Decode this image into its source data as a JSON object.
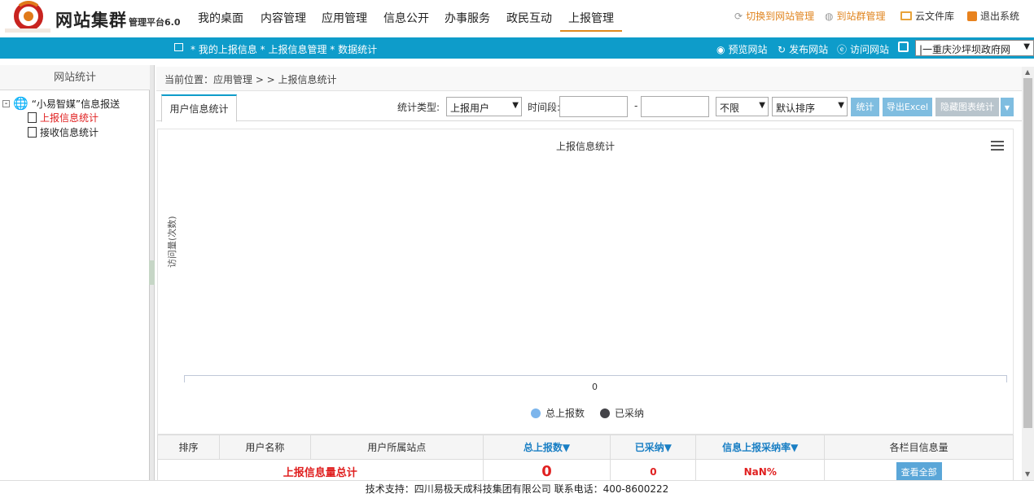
{
  "brand": {
    "name": "网站集群",
    "subtitle": "管理平台6.0"
  },
  "nav": [
    "我的桌面",
    "内容管理",
    "应用管理",
    "信息公开",
    "办事服务",
    "政民互动",
    "上报管理"
  ],
  "top_right": {
    "switch_site": "切换到网站管理",
    "cluster": "到站群管理",
    "cloud": "云文件库",
    "logout": "退出系统"
  },
  "bluebar": {
    "breadcrumb": "*  我的上报信息  *  上报信息管理  *  数据统计",
    "preview": "预览网站",
    "publish": "发布网站",
    "visit": "访问网站",
    "site_selected": "|一重庆沙坪坝政府网"
  },
  "sidebar": {
    "title": "网站统计",
    "root": "“小易智媒”信息报送",
    "items": [
      "上报信息统计",
      "接收信息统计"
    ]
  },
  "crumb": "当前位置：应用管理 > > 上报信息统计",
  "tab": "用户信息统计",
  "filters": {
    "type_label": "统计类型:",
    "type_value": "上报用户",
    "period_label": "时间段:",
    "dash": "-",
    "range_value": "不限",
    "sort_value": "默认排序",
    "btn_stat": "统计",
    "btn_export": "导出Excel",
    "btn_hide": "隐藏图表统计"
  },
  "chart_data": {
    "type": "bar",
    "title": "上报信息统计",
    "ylabel": "访问量(次数)",
    "categories": [
      "0"
    ],
    "series": [
      {
        "name": "总上报数",
        "color": "#7cb5ec",
        "values": []
      },
      {
        "name": "已采纳",
        "color": "#434348",
        "values": []
      }
    ]
  },
  "table": {
    "headers": [
      "排序",
      "用户名称",
      "用户所属站点",
      "总上报数▼",
      "已采纳▼",
      "信息上报采纳率▼",
      "各栏目信息量"
    ],
    "total_row": {
      "label": "上报信息量总计",
      "total": "0",
      "adopted": "0",
      "rate": "NaN%",
      "action": "查看全部"
    }
  },
  "footer": "技术支持：四川易极天成科技集团有限公司     联系电话：400-8600222"
}
